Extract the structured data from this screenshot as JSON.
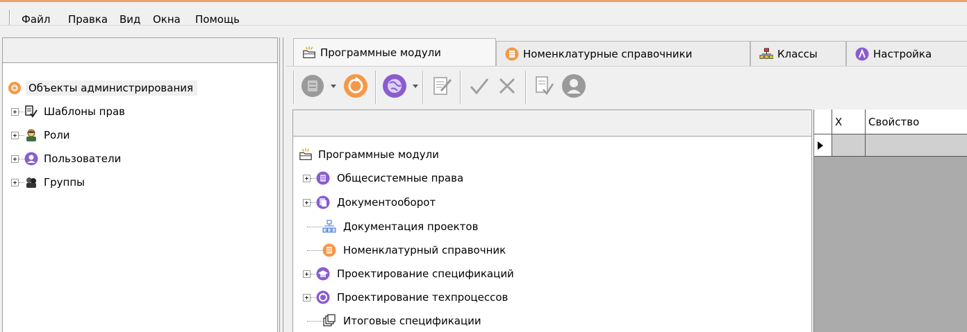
{
  "menu": [
    "Файл",
    "Правка",
    "Вид",
    "Окна",
    "Помощь"
  ],
  "left_tree": {
    "root": "Объекты администрирования",
    "items": [
      {
        "label": "Шаблоны прав",
        "icon": "rights-template-icon"
      },
      {
        "label": "Роли",
        "icon": "role-icon"
      },
      {
        "label": "Пользователи",
        "icon": "user-icon"
      },
      {
        "label": "Группы",
        "icon": "group-icon"
      }
    ]
  },
  "tabs": [
    {
      "label": "Программные модули",
      "icon": "modules-folder-icon",
      "active": true
    },
    {
      "label": "Номенклатурные справочники",
      "icon": "nomenclature-icon",
      "active": false
    },
    {
      "label": "Классы",
      "icon": "classes-icon",
      "active": false
    },
    {
      "label": "Настройка",
      "icon": "settings-icon",
      "active": false
    }
  ],
  "toolbar": {
    "buttons": [
      "document-stack-icon",
      "refresh-icon",
      "globe-icon",
      "edit-document-icon",
      "check-icon",
      "cancel-icon",
      "document-check-icon",
      "user-icon"
    ]
  },
  "module_tree": {
    "root": "Программные модули",
    "items": [
      {
        "label": "Общесистемные права",
        "expandable": true,
        "icon": "system-rights-icon"
      },
      {
        "label": "Документооборот",
        "expandable": true,
        "icon": "document-flow-icon"
      },
      {
        "label": "Документация проектов",
        "expandable": false,
        "icon": "project-docs-icon"
      },
      {
        "label": "Номенклатурный справочник",
        "expandable": false,
        "icon": "nomenclature-icon"
      },
      {
        "label": "Проектирование спецификаций",
        "expandable": true,
        "icon": "spec-design-icon"
      },
      {
        "label": "Проектирование техпроцессов",
        "expandable": true,
        "icon": "process-design-icon"
      },
      {
        "label": "Итоговые спецификации",
        "expandable": false,
        "icon": "final-spec-icon"
      }
    ]
  },
  "grid": {
    "columns": [
      "Х",
      "Свойство"
    ]
  },
  "colors": {
    "orange": "#f29a4a",
    "purple": "#8a5cd0",
    "accent_line": "#e8a070"
  }
}
